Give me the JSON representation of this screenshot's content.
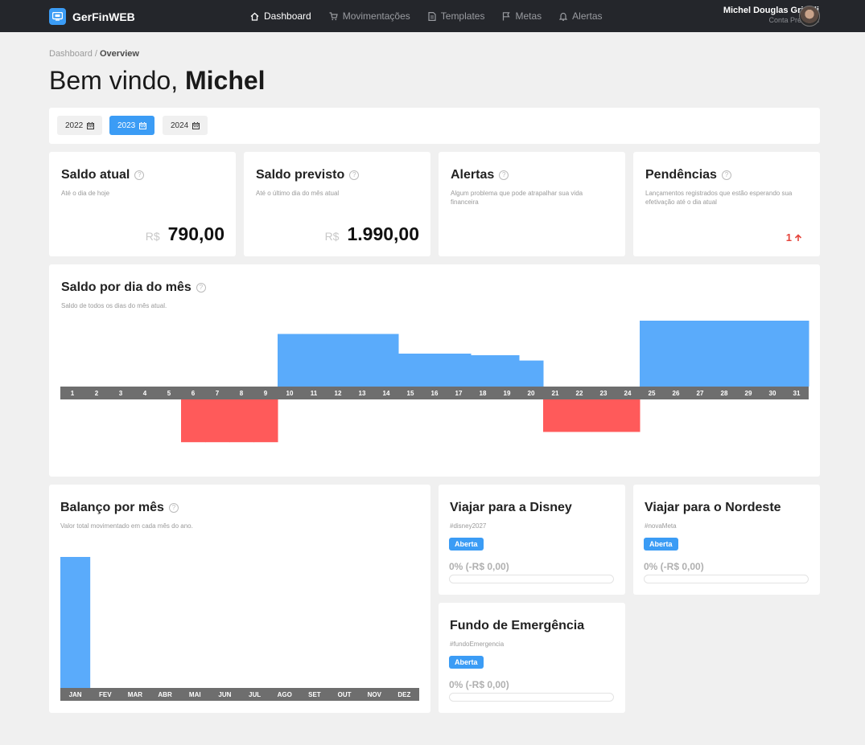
{
  "app": {
    "name": "GerFinWEB"
  },
  "nav": [
    {
      "label": "Dashboard",
      "icon": "home-icon",
      "active": true
    },
    {
      "label": "Movimentações",
      "icon": "cart-icon",
      "active": false
    },
    {
      "label": "Templates",
      "icon": "document-icon",
      "active": false
    },
    {
      "label": "Metas",
      "icon": "flag-icon",
      "active": false
    },
    {
      "label": "Alertas",
      "icon": "bell-icon",
      "active": false
    }
  ],
  "user": {
    "name": "Michel Douglas Grigoli",
    "plan": "Conta Premium"
  },
  "breadcrumb": {
    "root": "Dashboard",
    "separator": " / ",
    "current": "Overview"
  },
  "greeting": {
    "prefix": "Bem vindo, ",
    "name": "Michel"
  },
  "years": [
    {
      "label": "2022",
      "active": false
    },
    {
      "label": "2023",
      "active": true
    },
    {
      "label": "2024",
      "active": false
    }
  ],
  "cards": {
    "saldo_atual": {
      "title": "Saldo atual",
      "subtitle": "Até o dia de hoje",
      "currency": "R$",
      "value": "790,00"
    },
    "saldo_previsto": {
      "title": "Saldo previsto",
      "subtitle": "Até o último dia do mês atual",
      "currency": "R$",
      "value": "1.990,00"
    },
    "alertas": {
      "title": "Alertas",
      "subtitle": "Algum problema que pode atrapalhar sua vida financeira"
    },
    "pendencias": {
      "title": "Pendências",
      "subtitle": "Lançamentos registrados que estão esperando sua efetivação até o dia atual",
      "count": "1"
    }
  },
  "daily_chart": {
    "title": "Saldo por dia do mês",
    "subtitle": "Saldo de todos os dias do mês atual."
  },
  "monthly_chart": {
    "title": "Balanço por mês",
    "subtitle": "Valor total movimentado em cada mês do ano."
  },
  "chart_data": [
    {
      "type": "bar",
      "title": "Saldo por dia do mês",
      "categories": [
        "1",
        "2",
        "3",
        "4",
        "5",
        "6",
        "7",
        "8",
        "9",
        "10",
        "11",
        "12",
        "13",
        "14",
        "15",
        "16",
        "17",
        "18",
        "19",
        "20",
        "21",
        "22",
        "23",
        "24",
        "25",
        "26",
        "27",
        "28",
        "29",
        "30",
        "31"
      ],
      "values": [
        0,
        0,
        0,
        0,
        0,
        -1000,
        -1000,
        -1000,
        -1000,
        990,
        990,
        990,
        990,
        990,
        620,
        620,
        620,
        590,
        590,
        490,
        -760,
        -760,
        -760,
        -760,
        1240,
        1240,
        1240,
        1240,
        1240,
        1240,
        1240
      ],
      "ylim": [
        -1300,
        1300
      ],
      "colors": {
        "positive": "#5aabfb",
        "negative": "#ff5a5a",
        "axis": "#6e6e6e"
      }
    },
    {
      "type": "bar",
      "title": "Balanço por mês",
      "categories": [
        "JAN",
        "FEV",
        "MAR",
        "ABR",
        "MAI",
        "JUN",
        "JUL",
        "AGO",
        "SET",
        "OUT",
        "NOV",
        "DEZ"
      ],
      "values": [
        100,
        0,
        0,
        0,
        0,
        0,
        0,
        0,
        0,
        0,
        0,
        0
      ],
      "ylim": [
        0,
        100
      ],
      "colors": {
        "positive": "#5aabfb",
        "axis": "#6e6e6e"
      }
    }
  ],
  "goals": [
    {
      "title": "Viajar para a Disney",
      "tag": "#disney2027",
      "status": "Aberta",
      "progress": "0% (-R$ 0,00)",
      "fraction": 0
    },
    {
      "title": "Viajar para o Nordeste",
      "tag": "#novaMeta",
      "status": "Aberta",
      "progress": "0% (-R$ 0,00)",
      "fraction": 0
    },
    {
      "title": "Fundo de Emergência",
      "tag": "#fundoEmergencia",
      "status": "Aberta",
      "progress": "0% (-R$ 0,00)",
      "fraction": 0
    }
  ]
}
